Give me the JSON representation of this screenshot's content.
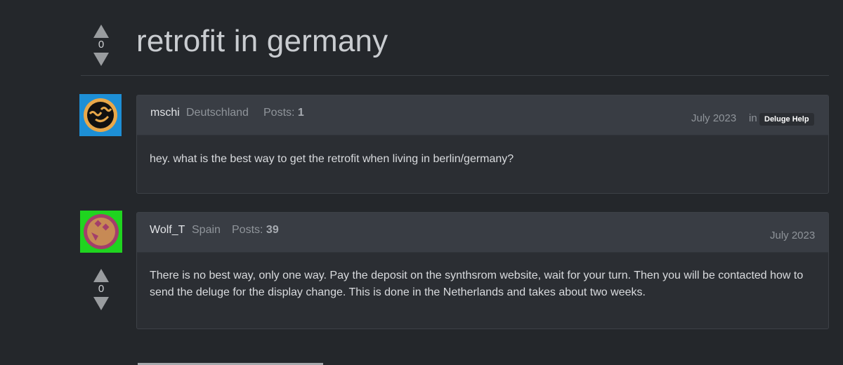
{
  "thread": {
    "title": "retrofit in germany",
    "score": "0"
  },
  "posts": [
    {
      "author": "mschi",
      "country": "Deutschland",
      "posts_label": "Posts:",
      "posts_count": "1",
      "date": "July 2023",
      "in_label": "in",
      "category": "Deluge Help",
      "body": "hey. what is the best way to get the retrofit when living in berlin/germany?",
      "avatar_bg": "#1d8fd6"
    },
    {
      "author": "Wolf_T",
      "country": "Spain",
      "posts_label": "Posts:",
      "posts_count": "39",
      "date": "July 2023",
      "score": "0",
      "body": "There is no best way, only one way. Pay the deposit on the synthsrom website, wait for your turn. Then you will be contacted how to send the deluge for the display change. This is done in the Netherlands and takes about two weeks.",
      "avatar_bg": "#1fd41f"
    }
  ],
  "colors": {
    "background": "#24272b",
    "post_header": "#393d44",
    "post_body": "#2b2e33",
    "vote_arrow": "#999c9f"
  },
  "icons": [
    "upvote-arrow-icon",
    "downvote-arrow-icon",
    "avatar-smiley-icon"
  ]
}
